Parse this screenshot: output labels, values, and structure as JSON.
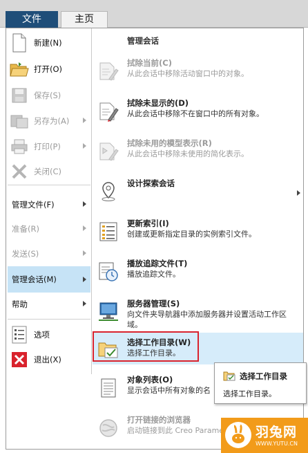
{
  "ribbon": {
    "file_tab": "文件",
    "home_tab": "主页"
  },
  "left_menu": [
    {
      "label": "新建(N)",
      "icon": "new-document-icon",
      "state": "enabled"
    },
    {
      "label": "打开(O)",
      "icon": "open-folder-icon",
      "state": "enabled"
    },
    {
      "label": "保存(S)",
      "icon": "save-icon",
      "state": "disabled"
    },
    {
      "label": "另存为(A)",
      "icon": "save-as-icon",
      "state": "disabled",
      "submenu": true
    },
    {
      "label": "打印(P)",
      "icon": "print-icon",
      "state": "disabled",
      "submenu": true
    },
    {
      "label": "关闭(C)",
      "icon": "close-x-icon",
      "state": "disabled"
    },
    {
      "label": "管理文件(F)",
      "state": "enabled",
      "submenu": true
    },
    {
      "label": "准备(R)",
      "state": "disabled",
      "submenu": true
    },
    {
      "label": "发送(S)",
      "state": "disabled",
      "submenu": true
    },
    {
      "label": "管理会话(M)",
      "state": "active",
      "submenu": true
    },
    {
      "label": "帮助",
      "state": "enabled",
      "submenu": true
    },
    {
      "label": "选项",
      "icon": "options-list-icon",
      "state": "enabled"
    },
    {
      "label": "退出(X)",
      "icon": "exit-icon",
      "state": "enabled"
    }
  ],
  "right_panel": {
    "header": "管理会话",
    "items": [
      {
        "title": "拭除当前(C)",
        "desc": "从此会话中移除活动窗口中的对象。",
        "icon": "erase-current-icon",
        "state": "disabled"
      },
      {
        "title": "拭除未显示的(D)",
        "desc": "从此会话中移除不在窗口中的所有对象。",
        "icon": "erase-not-displayed-icon",
        "state": "enabled"
      },
      {
        "title": "拭除未用的模型表示(R)",
        "desc": "从此会话中移除未使用的简化表示。",
        "icon": "erase-unused-reps-icon",
        "state": "disabled"
      },
      {
        "title": "设计探索会话",
        "desc": "",
        "icon": "location-pin-icon",
        "state": "enabled",
        "submenu": true
      },
      {
        "title": "更新索引(I)",
        "desc": "创建或更新指定目录的实例索引文件。",
        "icon": "index-list-icon",
        "state": "enabled"
      },
      {
        "title": "播放追踪文件(T)",
        "desc": "播放追踪文件。",
        "icon": "play-trail-icon",
        "state": "enabled"
      },
      {
        "title": "服务器管理(S)",
        "desc": "向文件夹导航器中添加服务器并设置活动工作区域。",
        "icon": "server-monitor-icon",
        "state": "enabled"
      },
      {
        "title": "选择工作目录(W)",
        "desc": "选择工作目录。",
        "icon": "working-directory-icon",
        "state": "selected"
      },
      {
        "title": "对象列表(O)",
        "desc": "显示会话中所有对象的名",
        "icon": "object-list-icon",
        "state": "enabled"
      },
      {
        "title": "打开链接的浏览器",
        "desc": "启动链接到此 Creo Parametric 的浏览器。",
        "icon": "browser-globe-icon",
        "state": "disabled"
      }
    ]
  },
  "tooltip": {
    "title": "选择工作目录",
    "desc": "选择工作目录。",
    "icon": "working-directory-icon"
  },
  "watermark": {
    "text": "羽兔网",
    "url": "WWW.YUTU.CN"
  },
  "colors": {
    "file_tab": "#1f4e79",
    "active_item": "#c6e3f6",
    "highlight_box": "#d9232d",
    "watermark": "#f29b1a"
  }
}
